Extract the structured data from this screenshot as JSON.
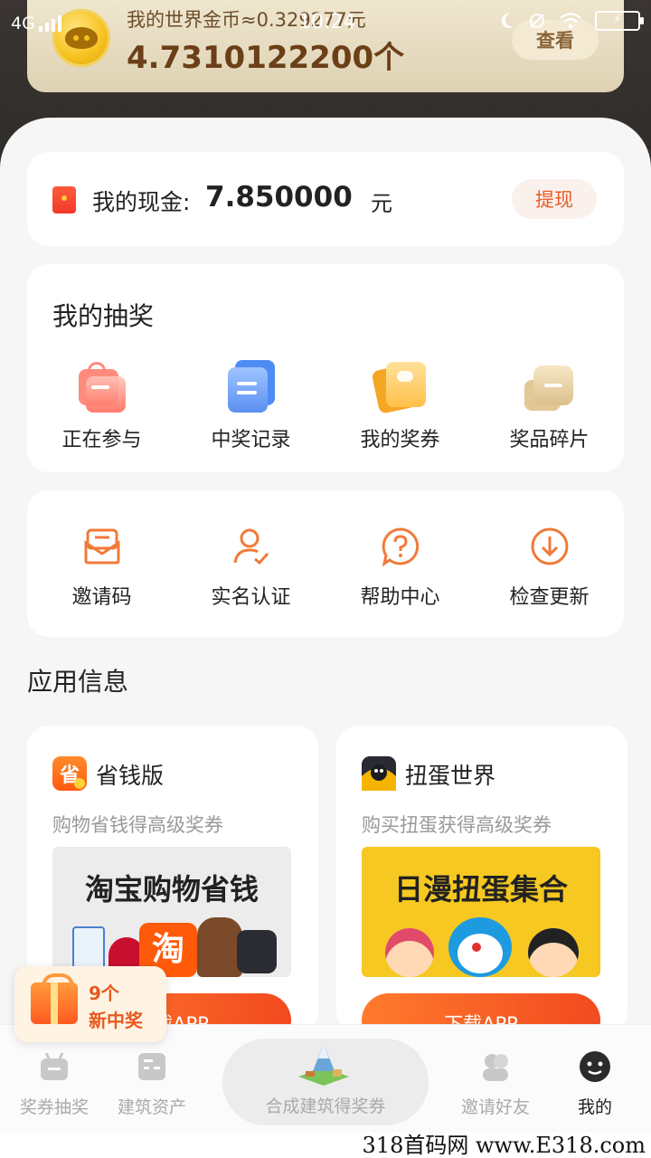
{
  "status_bar": {
    "network": "4G",
    "time": "10:24"
  },
  "coin_card": {
    "label": "我的世界金币≈0.329277元",
    "value": "4.7310122200个",
    "view_button": "查看"
  },
  "cash_card": {
    "label": "我的现金:",
    "value": "7.850000",
    "unit": "元",
    "withdraw_button": "提现"
  },
  "lottery": {
    "title": "我的抽奖",
    "items": [
      {
        "label": "正在参与",
        "icon": "gift-box-icon"
      },
      {
        "label": "中奖记录",
        "icon": "record-list-icon"
      },
      {
        "label": "我的奖券",
        "icon": "coupon-icon"
      },
      {
        "label": "奖品碎片",
        "icon": "puzzle-piece-icon"
      }
    ]
  },
  "tools": {
    "items": [
      {
        "label": "邀请码",
        "icon": "envelope-icon"
      },
      {
        "label": "实名认证",
        "icon": "user-verify-icon"
      },
      {
        "label": "帮助中心",
        "icon": "help-bubble-icon"
      },
      {
        "label": "检查更新",
        "icon": "download-arrow-icon"
      }
    ]
  },
  "app_info": {
    "title": "应用信息",
    "apps": [
      {
        "name": "省钱版",
        "description": "购物省钱得高级奖券",
        "banner_text": "淘宝购物省钱",
        "banner_badge": "淘",
        "button": "下载APP"
      },
      {
        "name": "扭蛋世界",
        "description": "购买扭蛋获得高级奖券",
        "banner_text": "日漫扭蛋集合",
        "button": "下载APP"
      }
    ]
  },
  "float_badge": {
    "line1": "9个",
    "line2": "新中奖"
  },
  "tab_bar": {
    "tabs": [
      {
        "label": "奖券抽奖"
      },
      {
        "label": "建筑资产"
      },
      {
        "label": "合成建筑得奖券"
      },
      {
        "label": "邀请好友"
      },
      {
        "label": "我的"
      }
    ]
  },
  "watermark": "318首码网 www.E318.com",
  "colors": {
    "accent": "#f24a1f",
    "gold": "#6b3f17",
    "card_bg": "#ffffff",
    "page_bg": "#f6f6f6"
  }
}
